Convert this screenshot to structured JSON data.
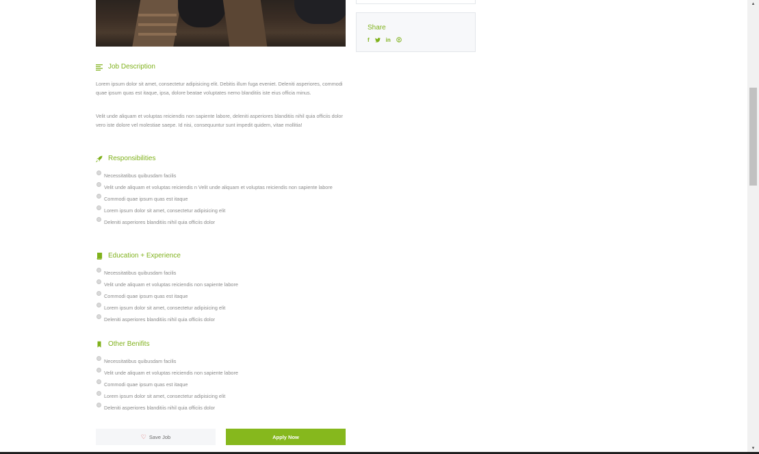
{
  "share": {
    "title": "Share",
    "icons": [
      {
        "name": "facebook-icon",
        "glyph": "f"
      },
      {
        "name": "twitter-icon",
        "glyph": "t"
      },
      {
        "name": "linkedin-icon",
        "glyph": "in"
      },
      {
        "name": "pinterest-icon",
        "glyph": "p"
      }
    ]
  },
  "job_description": {
    "heading": "Job Description",
    "paragraphs": [
      "Lorem ipsum dolor sit amet, consectetur adipisicing elit. Debitis illum fuga eveniet. Deleniti asperiores, commodi quae ipsum quas est itaque, ipsa, dolore beatae voluptates nemo blanditiis iste eius officia minus.",
      "Velit unde aliquam et voluptas reiciendis non sapiente labore, deleniti asperiores blanditiis nihil quia officiis dolor vero iste dolore vel molestiae saepe. Id nisi, consequuntur sunt impedit quidem, vitae mollitia!"
    ]
  },
  "responsibilities": {
    "heading": "Responsibilities",
    "items": [
      "Necessitatibus quibusdam facilis",
      "Velit unde aliquam et voluptas reiciendis n Velit unde aliquam et voluptas reiciendis non sapiente labore",
      "Commodi quae ipsum quas est itaque",
      "Lorem ipsum dolor sit amet, consectetur adipisicing elit",
      "Deleniti asperiores blanditiis nihil quia officiis dolor"
    ]
  },
  "education": {
    "heading": "Education + Experience",
    "items": [
      "Necessitatibus quibusdam facilis",
      "Velit unde aliquam et voluptas reiciendis non sapiente labore",
      "Commodi quae ipsum quas est itaque",
      "Lorem ipsum dolor sit amet, consectetur adipisicing elit",
      "Deleniti asperiores blanditiis nihil quia officiis dolor"
    ]
  },
  "benefits": {
    "heading": "Other Benifits",
    "items": [
      "Necessitatibus quibusdam facilis",
      "Velit unde aliquam et voluptas reiciendis non sapiente labore",
      "Commodi quae ipsum quas est itaque",
      "Lorem ipsum dolor sit amet, consectetur adipisicing elit",
      "Deleniti asperiores blanditiis nihil quia officiis dolor"
    ]
  },
  "actions": {
    "save_label": "Save Job",
    "apply_label": "Apply Now"
  },
  "colors": {
    "accent": "#7fb11b",
    "apply_button": "#86b81d"
  }
}
